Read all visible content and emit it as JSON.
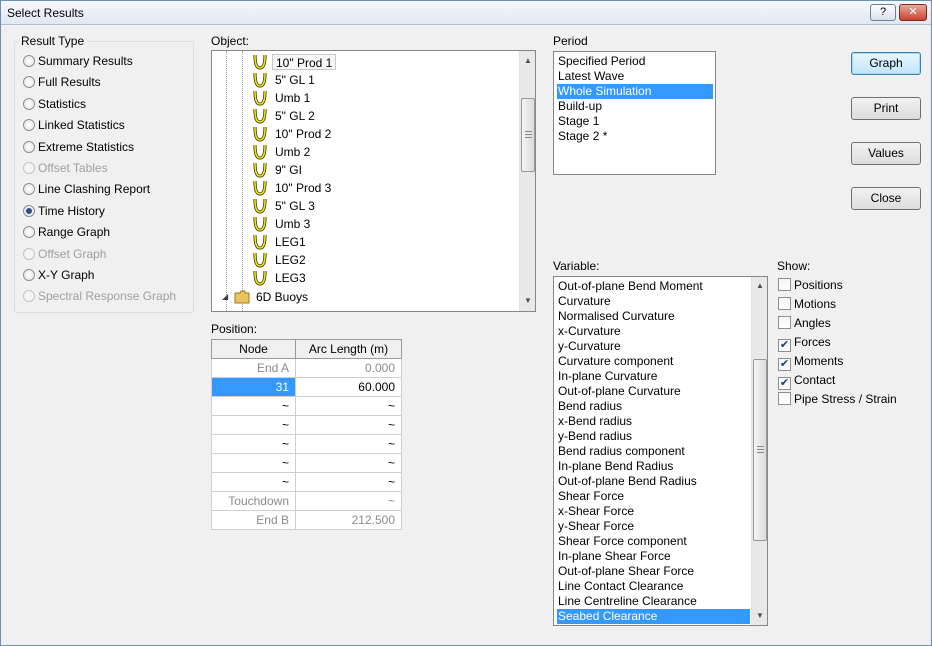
{
  "window": {
    "title": "Select Results",
    "help_label": "?",
    "close_label": "✕"
  },
  "result_type": {
    "label": "Result Type",
    "items": [
      {
        "label": "Summary Results",
        "checked": false,
        "enabled": true
      },
      {
        "label": "Full Results",
        "checked": false,
        "enabled": true
      },
      {
        "label": "Statistics",
        "checked": false,
        "enabled": true
      },
      {
        "label": "Linked Statistics",
        "checked": false,
        "enabled": true
      },
      {
        "label": "Extreme Statistics",
        "checked": false,
        "enabled": true
      },
      {
        "label": "Offset Tables",
        "checked": false,
        "enabled": false
      },
      {
        "label": "Line Clashing Report",
        "checked": false,
        "enabled": true
      },
      {
        "label": "Time History",
        "checked": true,
        "enabled": true
      },
      {
        "label": "Range Graph",
        "checked": false,
        "enabled": true
      },
      {
        "label": "Offset Graph",
        "checked": false,
        "enabled": false
      },
      {
        "label": "X-Y Graph",
        "checked": false,
        "enabled": true
      },
      {
        "label": "Spectral Response Graph",
        "checked": false,
        "enabled": false
      }
    ]
  },
  "object": {
    "label": "Object:",
    "items": [
      {
        "label": "10\" Prod 1",
        "icon": "line-icon",
        "selected": true
      },
      {
        "label": "5\" GL 1",
        "icon": "line-icon"
      },
      {
        "label": "Umb 1",
        "icon": "line-icon"
      },
      {
        "label": "5\" GL 2",
        "icon": "line-icon"
      },
      {
        "label": "10\" Prod 2",
        "icon": "line-icon"
      },
      {
        "label": "Umb 2",
        "icon": "line-icon"
      },
      {
        "label": "9\" GI",
        "icon": "line-icon"
      },
      {
        "label": "10\" Prod 3",
        "icon": "line-icon"
      },
      {
        "label": "5\" GL 3",
        "icon": "line-icon"
      },
      {
        "label": "Umb 3",
        "icon": "line-icon"
      },
      {
        "label": "LEG1",
        "icon": "line-icon"
      },
      {
        "label": "LEG2",
        "icon": "line-icon"
      },
      {
        "label": "LEG3",
        "icon": "line-icon"
      }
    ],
    "folder": {
      "label": "6D Buoys",
      "icon": "folder-icon"
    }
  },
  "position": {
    "label": "Position:",
    "headers": [
      "Node",
      "Arc Length (m)"
    ],
    "rows": [
      {
        "node": "End A",
        "arc": "0.000",
        "grey": true
      },
      {
        "node": "31",
        "arc": "60.000",
        "selected": true
      },
      {
        "node": "~",
        "arc": "~"
      },
      {
        "node": "~",
        "arc": "~"
      },
      {
        "node": "~",
        "arc": "~"
      },
      {
        "node": "~",
        "arc": "~"
      },
      {
        "node": "~",
        "arc": "~"
      },
      {
        "node": "Touchdown",
        "arc": "~",
        "grey": true
      },
      {
        "node": "End B",
        "arc": "212.500",
        "grey": true
      }
    ]
  },
  "period": {
    "label": "Period",
    "items": [
      "Specified Period",
      "Latest Wave",
      "Whole Simulation",
      "Build-up",
      "Stage 1",
      "Stage 2 *"
    ],
    "selected_index": 2
  },
  "variable": {
    "label": "Variable:",
    "items": [
      "Out-of-plane Bend Moment",
      "Curvature",
      "Normalised Curvature",
      "x-Curvature",
      "y-Curvature",
      "Curvature component",
      "In-plane Curvature",
      "Out-of-plane Curvature",
      "Bend radius",
      "x-Bend radius",
      "y-Bend radius",
      "Bend radius component",
      "In-plane Bend Radius",
      "Out-of-plane Bend Radius",
      "Shear Force",
      "x-Shear Force",
      "y-Shear Force",
      "Shear Force component",
      "In-plane Shear Force",
      "Out-of-plane Shear Force",
      "Line Contact Clearance",
      "Line Centreline Clearance",
      "Seabed Clearance"
    ],
    "selected_index": 22
  },
  "show": {
    "label": "Show:",
    "items": [
      {
        "label": "Positions",
        "checked": false
      },
      {
        "label": "Motions",
        "checked": false
      },
      {
        "label": "Angles",
        "checked": false
      },
      {
        "label": "Forces",
        "checked": true
      },
      {
        "label": "Moments",
        "checked": true
      },
      {
        "label": "Contact",
        "checked": true
      },
      {
        "label": "Pipe Stress / Strain",
        "checked": false
      }
    ]
  },
  "buttons": {
    "graph": "Graph",
    "print": "Print",
    "values": "Values",
    "close": "Close"
  }
}
